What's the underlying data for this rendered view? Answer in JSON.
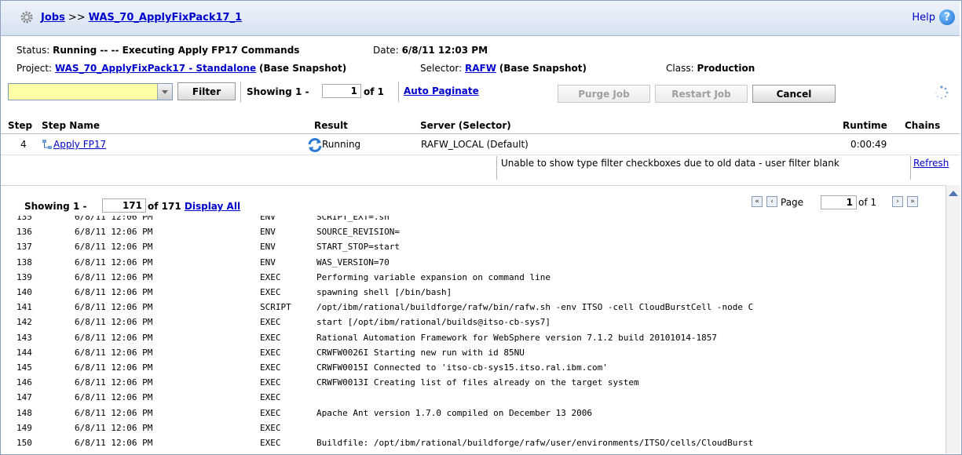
{
  "header": {
    "jobs_link": "Jobs",
    "separator": ">>",
    "job_name": "WAS_70_ApplyFixPack17_1",
    "help_label": "Help",
    "help_icon": "?"
  },
  "status": {
    "status_label": "Status:",
    "status_value": "Running -- -- Executing Apply FP17 Commands",
    "date_label": "Date:",
    "date_value": "6/8/11 12:03 PM",
    "project_label": "Project:",
    "project_value": "WAS_70_ApplyFixPack17 - Standalone",
    "project_suffix": "(Base Snapshot)",
    "selector_label": "Selector:",
    "selector_value": "RAFW",
    "selector_suffix": "(Base Snapshot)",
    "class_label": "Class:",
    "class_value": "Production"
  },
  "toolbar": {
    "filter_value": "",
    "filter_button": "Filter",
    "showing_label": "Showing 1 -",
    "showing_value": "1",
    "showing_of": "of 1",
    "auto_paginate": "Auto Paginate",
    "purge_button": "Purge Job",
    "restart_button": "Restart Job",
    "cancel_button": "Cancel"
  },
  "steps": {
    "columns": {
      "step": "Step",
      "step_name": "Step Name",
      "result": "Result",
      "server": "Server (Selector)",
      "runtime": "Runtime",
      "chains": "Chains"
    },
    "rows": [
      {
        "step": "4",
        "name": "Apply FP17",
        "result": "Running",
        "server": "RAFW_LOCAL (Default)",
        "runtime": "0:00:49"
      }
    ],
    "warning": "Unable to show type filter checkboxes due to old data - user filter blank",
    "refresh": "Refresh"
  },
  "log": {
    "showing_label": "Showing 1 -",
    "showing_value": "171",
    "showing_of": "of 171",
    "display_all": "Display All",
    "page_label": "Page",
    "page_value": "1",
    "page_of": "of 1",
    "rows": [
      {
        "n": "135",
        "date": "6/8/11 12:06 PM",
        "type": "ENV",
        "msg": "SCRIPT_EXT=.sh"
      },
      {
        "n": "136",
        "date": "6/8/11 12:06 PM",
        "type": "ENV",
        "msg": "SOURCE_REVISION="
      },
      {
        "n": "137",
        "date": "6/8/11 12:06 PM",
        "type": "ENV",
        "msg": "START_STOP=start"
      },
      {
        "n": "138",
        "date": "6/8/11 12:06 PM",
        "type": "ENV",
        "msg": "WAS_VERSION=70"
      },
      {
        "n": "139",
        "date": "6/8/11 12:06 PM",
        "type": "EXEC",
        "msg": "Performing variable expansion on command line"
      },
      {
        "n": "140",
        "date": "6/8/11 12:06 PM",
        "type": "EXEC",
        "msg": "spawning shell [/bin/bash]"
      },
      {
        "n": "141",
        "date": "6/8/11 12:06 PM",
        "type": "SCRIPT",
        "msg": "/opt/ibm/rational/buildforge/rafw/bin/rafw.sh -env ITSO -cell CloudBurstCell -node C"
      },
      {
        "n": "142",
        "date": "6/8/11 12:06 PM",
        "type": "EXEC",
        "msg": "start [/opt/ibm/rational/builds@itso-cb-sys7]"
      },
      {
        "n": "143",
        "date": "6/8/11 12:06 PM",
        "type": "EXEC",
        "msg": "Rational Automation Framework for WebSphere version 7.1.2 build 20101014-1857"
      },
      {
        "n": "144",
        "date": "6/8/11 12:06 PM",
        "type": "EXEC",
        "msg": "CRWFW0026I Starting new run with id 85NU"
      },
      {
        "n": "145",
        "date": "6/8/11 12:06 PM",
        "type": "EXEC",
        "msg": "CRWFW0015I Connected to 'itso-cb-sys15.itso.ral.ibm.com'"
      },
      {
        "n": "146",
        "date": "6/8/11 12:06 PM",
        "type": "EXEC",
        "msg": "CRWFW0013I Creating list of files already on the target system"
      },
      {
        "n": "147",
        "date": "6/8/11 12:06 PM",
        "type": "EXEC",
        "msg": ""
      },
      {
        "n": "148",
        "date": "6/8/11 12:06 PM",
        "type": "EXEC",
        "msg": "Apache Ant version 1.7.0 compiled on December 13 2006"
      },
      {
        "n": "149",
        "date": "6/8/11 12:06 PM",
        "type": "EXEC",
        "msg": ""
      },
      {
        "n": "150",
        "date": "6/8/11 12:06 PM",
        "type": "EXEC",
        "msg": "Buildfile: /opt/ibm/rational/buildforge/rafw/user/environments/ITSO/cells/CloudBurst"
      }
    ]
  }
}
